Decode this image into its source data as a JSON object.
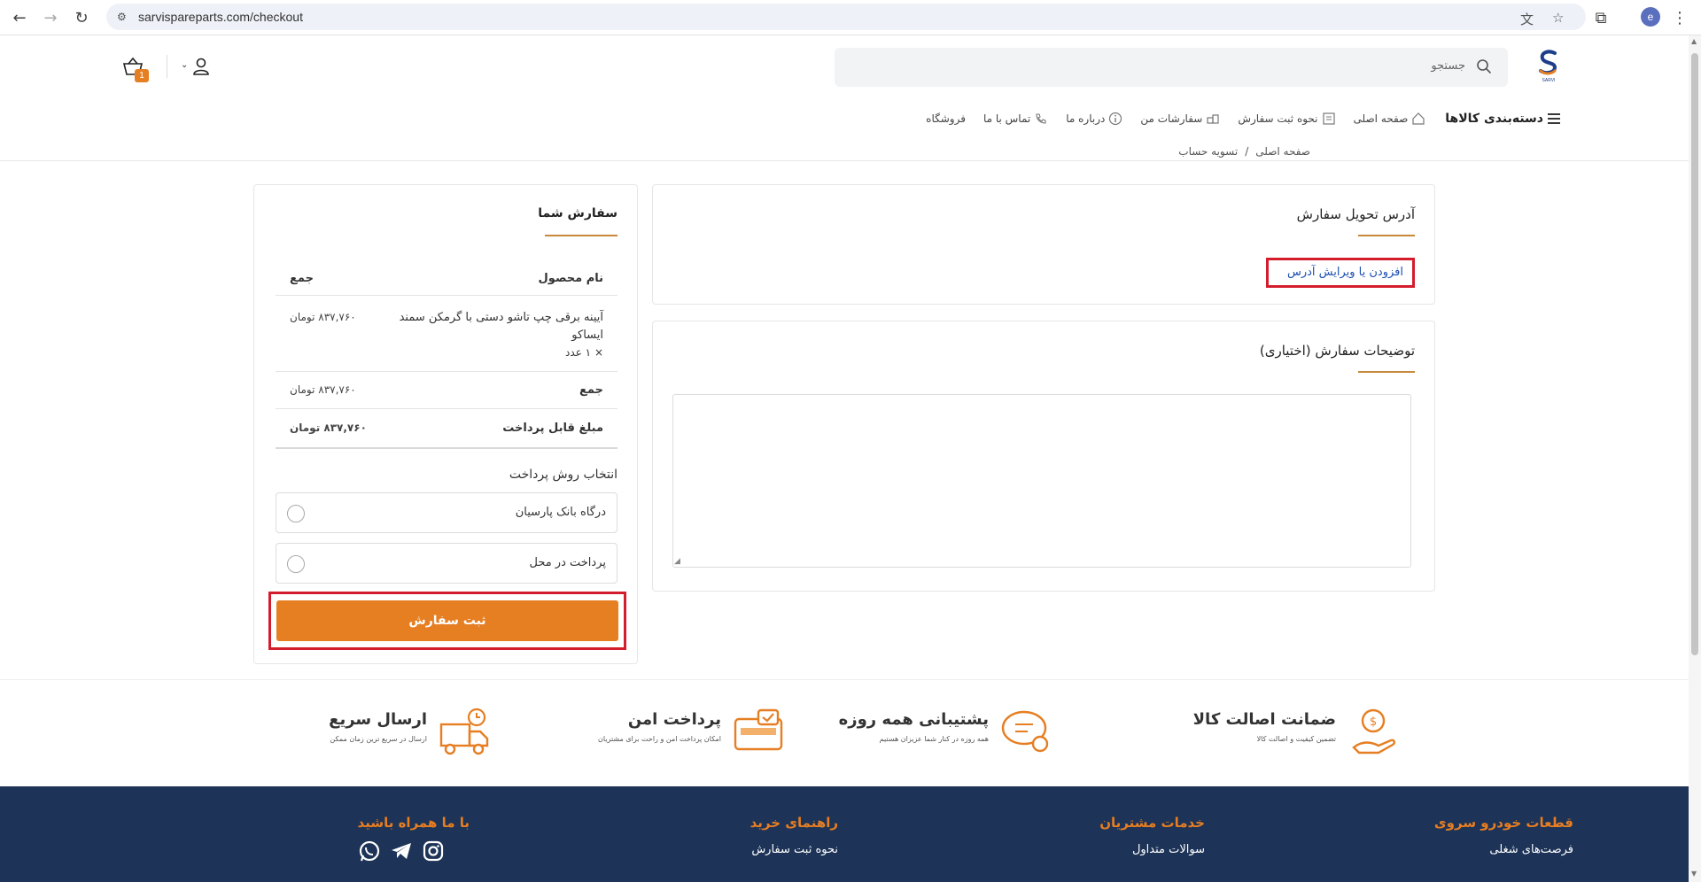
{
  "browser": {
    "url": "sarvispareparts.com/checkout",
    "profile_initial": "e"
  },
  "header": {
    "search_placeholder": "جستجو",
    "cart_count": "1",
    "logo_text": "SARVI"
  },
  "nav": {
    "categories": "دسته‌بندی کالاها",
    "items": [
      "صفحه اصلی",
      "نحوه ثبت سفارش",
      "سفارشات من",
      "درباره ما",
      "تماس با ما",
      "فروشگاه"
    ]
  },
  "breadcrumb": {
    "home": "صفحه اصلی",
    "separator": "/",
    "current": "تسویه حساب"
  },
  "address": {
    "title": "آدرس تحویل سفارش",
    "link": "افزودن یا ویرایش آدرس"
  },
  "notes": {
    "title": "توضیحات سفارش (اختیاری)",
    "value": ""
  },
  "order": {
    "title": "سفارش شما",
    "col_product": "نام محصول",
    "col_total": "جمع",
    "product_name": "آیینه برقی چپ تاشو دستی با گرمکن سمند ایساکو",
    "product_qty": "× ۱ عدد",
    "product_price": "۸۳۷,۷۶۰ تومان",
    "subtotal_label": "جمع",
    "subtotal_value": "۸۳۷,۷۶۰ تومان",
    "payable_label": "مبلغ قابل پرداخت",
    "payable_value": "۸۳۷,۷۶۰ تومان",
    "payment_title": "انتخاب روش پرداخت",
    "payment_options": [
      "درگاه بانک پارسیان",
      "پرداخت در محل"
    ],
    "submit": "ثبت سفارش"
  },
  "features": [
    {
      "title": "ضمانت اصالت کالا",
      "subtitle": "تضمین کیفیت و اصالت کالا"
    },
    {
      "title": "پشتیبانی همه روزه",
      "subtitle": "همه روزه در کنار شما عزیزان هستیم"
    },
    {
      "title": "پرداخت امن",
      "subtitle": "امکان پرداخت امن و راحت برای مشتریان"
    },
    {
      "title": "ارسال سریع",
      "subtitle": "ارسال در سریع ترین زمان ممکن"
    }
  ],
  "footer": {
    "col1": {
      "title": "قطعات خودرو سروی",
      "link": "فرصت‌های شغلی"
    },
    "col2": {
      "title": "خدمات مشتریان",
      "link": "سوالات متداول"
    },
    "col3": {
      "title": "راهنمای خرید",
      "link": "نحوه ثبت سفارش"
    },
    "col4": {
      "title": "با ما همراه باشید"
    }
  },
  "colors": {
    "accent": "#e67e22",
    "footer_bg": "#1d3357",
    "highlight": "#d41d2c",
    "link": "#1c4fb3"
  }
}
